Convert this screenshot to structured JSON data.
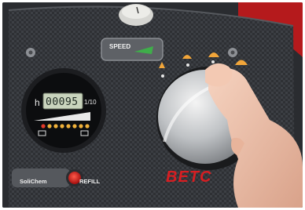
{
  "hour_meter": {
    "unit_label": "h",
    "reading": "00095",
    "tenths_label": "1/10"
  },
  "speed_panel": {
    "label": "SPEED"
  },
  "solution_panel": {
    "label": "SoliChem",
    "refill_label": "REFILL"
  },
  "brand": {
    "logo_text": "BETC"
  },
  "colors": {
    "panel_red": "#d81e22",
    "indicator_amber": "#f2a63a",
    "lcd_green": "#c9d4bd"
  }
}
